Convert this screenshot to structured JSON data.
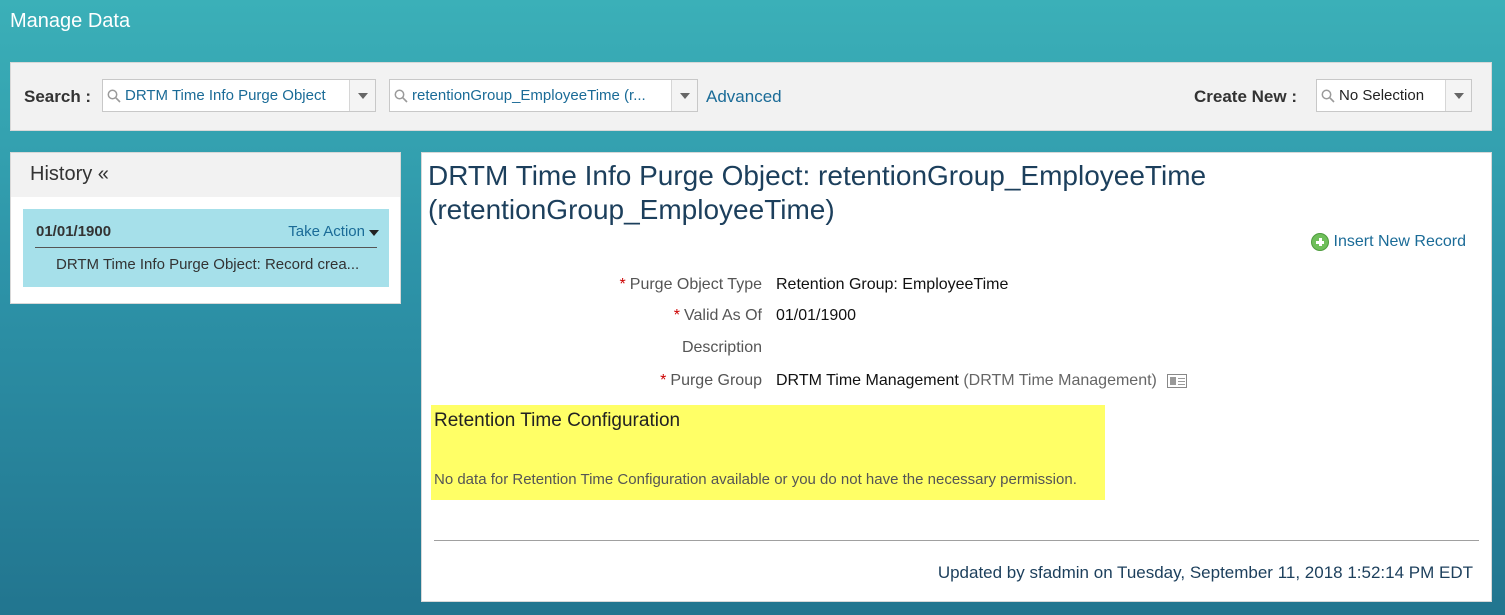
{
  "page": {
    "title": "Manage Data"
  },
  "search": {
    "label": "Search :",
    "object_type_value": "DRTM Time Info Purge Object",
    "object_value": "retentionGroup_EmployeeTime (r...",
    "advanced_label": "Advanced"
  },
  "create_new": {
    "label": "Create New :",
    "value": "No Selection"
  },
  "history": {
    "header": "History «",
    "items": [
      {
        "date": "01/01/1900",
        "action_label": "Take Action",
        "description": "DRTM Time Info Purge Object: Record crea..."
      }
    ]
  },
  "record": {
    "title": "DRTM Time Info Purge Object: retentionGroup_EmployeeTime (retentionGroup_EmployeeTime)",
    "insert_label": "Insert New Record",
    "fields": [
      {
        "label": "Purge Object Type",
        "required": "*",
        "value": "Retention Group: EmployeeTime"
      },
      {
        "label": "Valid As Of",
        "required": "*",
        "value": "01/01/1900"
      },
      {
        "label": "Description",
        "required": "",
        "value": ""
      },
      {
        "label": "Purge Group",
        "required": "*",
        "value": "DRTM Time Management",
        "sub_value": "(DRTM Time Management)"
      }
    ],
    "retention": {
      "title": "Retention Time Configuration",
      "message": "No data for Retention Time Configuration available or you do not have the necessary permission."
    },
    "updated_by": "Updated by sfadmin on Tuesday, September 11, 2018 1:52:14 PM EDT"
  },
  "icons": {
    "search": "magnifier-icon",
    "dropdown": "chevron-down-icon",
    "insert": "plus-circle-icon",
    "details": "card-icon"
  },
  "colors": {
    "link": "#1a6b97",
    "highlight": "#ffff66",
    "history_item_bg": "#a6e0ea",
    "required": "#cc0000"
  }
}
